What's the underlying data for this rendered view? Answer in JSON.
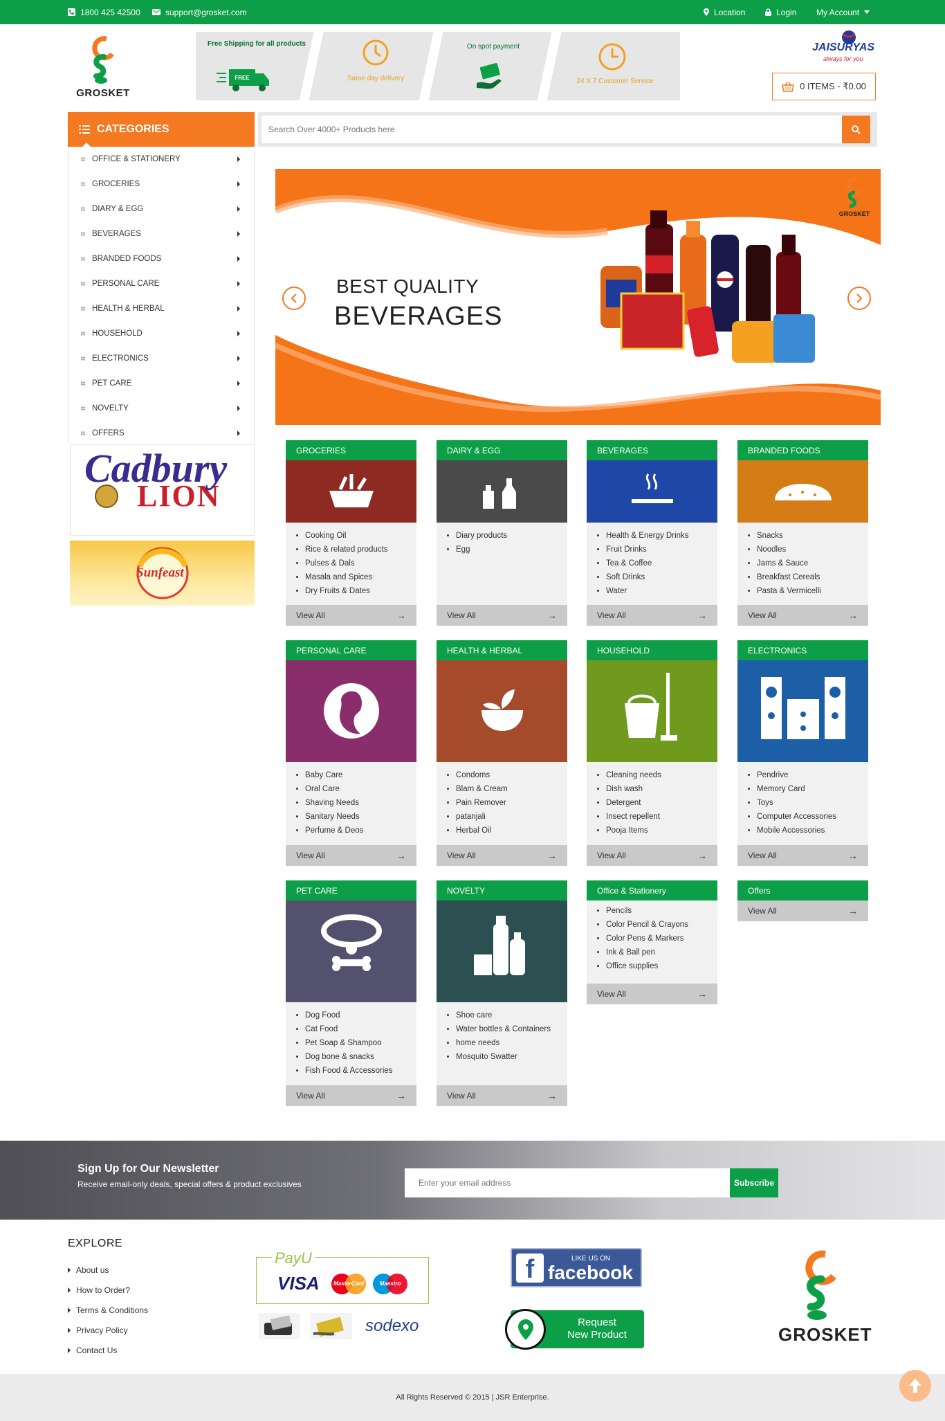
{
  "topbar": {
    "phone": "1800 425 42500",
    "email": "support@grosket.com",
    "location": "Location",
    "login": "Login",
    "account": "My Account"
  },
  "header": {
    "logo_text": "GROSKET",
    "features": [
      {
        "title": "Free Shipping for all products",
        "badge": "FREE DELIVERY"
      },
      {
        "title": "Same day delivery",
        "badge": "SAME DAY DELIVERY"
      },
      {
        "title": "On spot payment",
        "badge": "₹"
      },
      {
        "title": "24 X 7 Customer Service",
        "badge": "24h"
      }
    ],
    "partner_brand": "JAISURYAS",
    "partner_tagline": "always for you",
    "cart_label": "0 ITEMS - ₹0.00"
  },
  "categories": {
    "title": "CATEGORIES",
    "items": [
      "OFFICE & STATIONERY",
      "GROCERIES",
      "DIARY & EGG",
      "BEVERAGES",
      "BRANDED FOODS",
      "PERSONAL CARE",
      "HEALTH & HERBAL",
      "HOUSEHOLD",
      "ELECTRONICS",
      "PET CARE",
      "NOVELTY",
      "OFFERS"
    ]
  },
  "ads": {
    "cadbury": "Cadbury",
    "lion": "LION",
    "sunfeast": "Sunfeast"
  },
  "search": {
    "placeholder": "Search Over 4000+ Products here"
  },
  "slider": {
    "line1": "BEST QUALITY",
    "line2": "BEVERAGES",
    "logo_text": "GROSKET"
  },
  "cards": [
    {
      "title": "GROCERIES",
      "items": [
        "Cooking Oil",
        "Rice & related products",
        "Pulses & Dals",
        "Masala and Spices",
        "Dry Fruits & Dates"
      ],
      "view_all": "View All",
      "color": "#8e2a22"
    },
    {
      "title": "DAIRY & EGG",
      "items": [
        "Diary products",
        "Egg"
      ],
      "view_all": "View All",
      "color": "#4a4a4a"
    },
    {
      "title": "BEVERAGES",
      "items": [
        "Health & Energy Drinks",
        "Fruit Drinks",
        "Tea & Coffee",
        "Soft Drinks",
        "Water"
      ],
      "view_all": "View All",
      "color": "#1f47a8"
    },
    {
      "title": "BRANDED FOODS",
      "items": [
        "Snacks",
        "Noodles",
        "Jams & Sauce",
        "Breakfast Cereals",
        "Pasta & Vermicelli"
      ],
      "view_all": "View All",
      "color": "#d47c16"
    },
    {
      "title": "PERSONAL CARE",
      "items": [
        "Baby Care",
        "Oral Care",
        "Shaving Needs",
        "Sanitary Needs",
        "Perfume & Deos"
      ],
      "view_all": "View All",
      "color": "#8a2e6b"
    },
    {
      "title": "HEALTH & HERBAL",
      "items": [
        "Condoms",
        "Blam & Cream",
        "Pain Remover",
        "patanjali",
        "Herbal Oil"
      ],
      "view_all": "View All",
      "color": "#a64a2c"
    },
    {
      "title": "HOUSEHOLD",
      "items": [
        "Cleaning needs",
        "Dish wash",
        "Detergent",
        "Insect repellent",
        "Pooja Items"
      ],
      "view_all": "View All",
      "color": "#6f9a1e"
    },
    {
      "title": "ELECTRONICS",
      "items": [
        "Pendrive",
        "Memory Card",
        "Toys",
        "Computer Accessories",
        "Mobile Accessories"
      ],
      "view_all": "View All",
      "color": "#1d5fa6"
    },
    {
      "title": "PET CARE",
      "items": [
        "Dog Food",
        "Cat Food",
        "Pet Soap & Shampoo",
        "Dog bone & snacks",
        "Fish Food & Accessories"
      ],
      "view_all": "View All",
      "color": "#54516e"
    },
    {
      "title": "NOVELTY",
      "items": [
        "Shoe care",
        "Water bottles & Containers",
        "home needs",
        "Mosquito Swatter"
      ],
      "view_all": "View All",
      "color": "#2c4f52"
    },
    {
      "title": "Office & Stationery",
      "items": [
        "Pencils",
        "Color Pencil & Crayons",
        "Color Pens & Markers",
        "Ink & Ball pen",
        "Office supplies"
      ],
      "view_all": "View All"
    },
    {
      "title": "Offers",
      "items": [],
      "view_all": "View All"
    }
  ],
  "newsletter": {
    "title": "Sign Up for Our Newsletter",
    "subtitle": "Receive email-only deals, special offers & product exclusives",
    "placeholder": "Enter your email address",
    "button": "Subscribe"
  },
  "footer": {
    "explore_title": "EXPLORE",
    "links": [
      "About us",
      "How to Order?",
      "Terms & Conditions",
      "Privacy Policy",
      "Contact Us"
    ],
    "payu": "PayU",
    "visa": "VISA",
    "mastercard": "MasterCard",
    "maestro": "Maestro",
    "sodexo": "sodexo",
    "fb_like": "LIKE US ON",
    "fb_name": "facebook",
    "request_line1": "Request",
    "request_line2": "New Product",
    "logo_text": "GROSKET",
    "copyright": "All Rights Reserved © 2015 | JSR Enterprise."
  },
  "colors": {
    "green": "#0d9f48",
    "orange": "#f47920"
  }
}
